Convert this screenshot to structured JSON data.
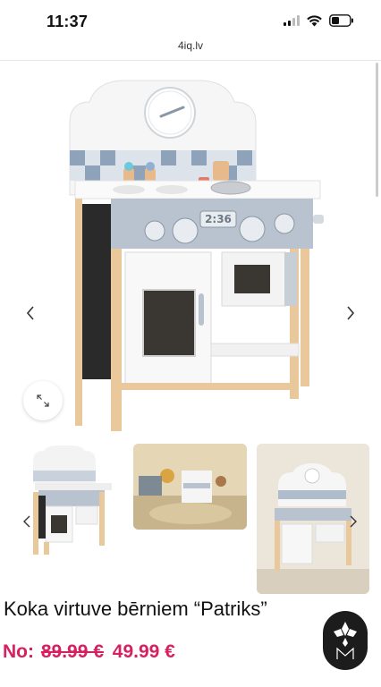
{
  "status": {
    "time": "11:37",
    "signal_icon": "cellular-signal-icon",
    "wifi_icon": "wifi-icon",
    "battery_icon": "battery-icon"
  },
  "browser": {
    "url": "4iq.lv"
  },
  "gallery": {
    "prev_icon": "chevron-left-icon",
    "next_icon": "chevron-right-icon",
    "zoom_icon": "expand-icon",
    "clock_display": "2:36"
  },
  "product": {
    "title": "Koka virtuve bērniem “Patriks”",
    "price_prefix": "No:",
    "price_old": "89.99 €",
    "price_new": "49.99 €",
    "price_color": "#d62060"
  },
  "chat": {
    "icon": "brand-logo-icon"
  }
}
